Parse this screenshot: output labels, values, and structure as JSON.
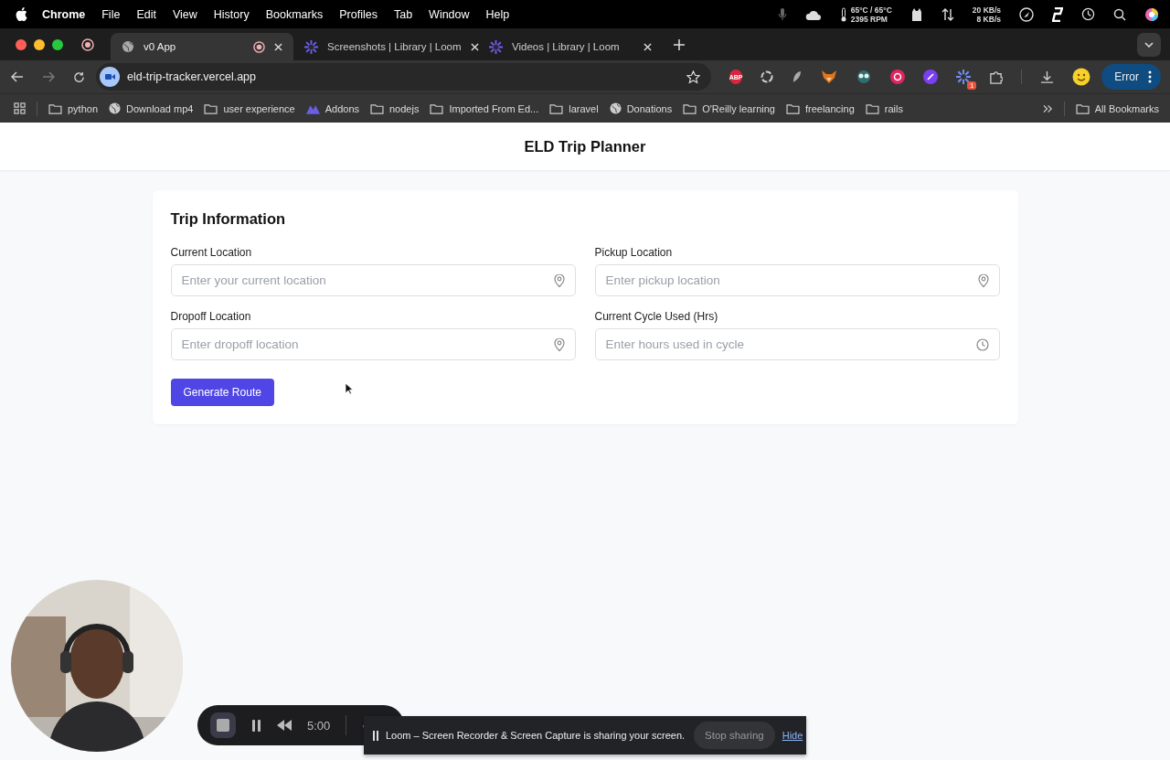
{
  "menubar": {
    "app": "Chrome",
    "menus": [
      "File",
      "Edit",
      "View",
      "History",
      "Bookmarks",
      "Profiles",
      "Tab",
      "Window",
      "Help"
    ],
    "temperature": "65°C / 65°C",
    "fan": "2395 RPM",
    "net_up": "20 KB/s",
    "net_down": "8 KB/s"
  },
  "tabs": [
    {
      "title": "v0 App",
      "selected": true,
      "kind": "globe",
      "recording": true
    },
    {
      "title": "Screenshots | Library | Loom",
      "selected": false,
      "kind": "loom",
      "recording": false
    },
    {
      "title": "Videos | Library | Loom",
      "selected": false,
      "kind": "loom",
      "recording": false
    }
  ],
  "address": "eld-trip-tracker.vercel.app",
  "extensions": {
    "adblock": "ABP",
    "badge": "1",
    "profile_button": "Error"
  },
  "bookmarks": [
    {
      "label": "python",
      "kind": "folder"
    },
    {
      "label": "Download mp4",
      "kind": "globe"
    },
    {
      "label": "user experience",
      "kind": "folder"
    },
    {
      "label": "Addons",
      "kind": "addons"
    },
    {
      "label": "nodejs",
      "kind": "folder"
    },
    {
      "label": "Imported From Ed...",
      "kind": "folder"
    },
    {
      "label": "laravel",
      "kind": "folder"
    },
    {
      "label": "Donations",
      "kind": "globe"
    },
    {
      "label": "O'Reilly learning",
      "kind": "folder"
    },
    {
      "label": "freelancing",
      "kind": "folder"
    },
    {
      "label": "rails",
      "kind": "folder"
    }
  ],
  "all_bookmarks": "All Bookmarks",
  "page": {
    "title": "ELD Trip Planner",
    "card_title": "Trip Information",
    "fields": [
      {
        "label": "Current Location",
        "placeholder": "Enter your current location",
        "kind": "place"
      },
      {
        "label": "Pickup Location",
        "placeholder": "Enter pickup location",
        "kind": "place"
      },
      {
        "label": "Dropoff Location",
        "placeholder": "Enter dropoff location",
        "kind": "place"
      },
      {
        "label": "Current Cycle Used (Hrs)",
        "placeholder": "Enter hours used in cycle",
        "kind": "hours"
      }
    ],
    "button": "Generate Route"
  },
  "recorder": {
    "timer": "5:00",
    "banner": "Loom – Screen Recorder & Screen Capture is sharing your screen.",
    "stop_button": "Stop sharing",
    "hide_link": "Hide"
  }
}
